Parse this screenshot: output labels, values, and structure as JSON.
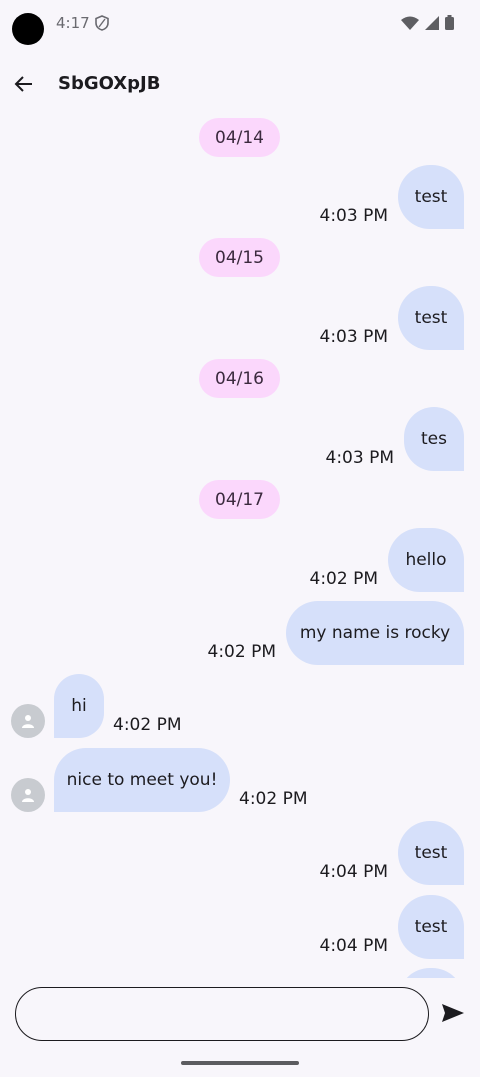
{
  "status_bar": {
    "time": "4:17"
  },
  "app_bar": {
    "title": "SbGOXpJB"
  },
  "dates": {
    "d1": "04/14",
    "d2": "04/15",
    "d3": "04/16",
    "d4": "04/17"
  },
  "messages": [
    {
      "text": "test",
      "time": "4:03 PM"
    },
    {
      "text": "test",
      "time": "4:03 PM"
    },
    {
      "text": "tes",
      "time": "4:03 PM"
    },
    {
      "text": "hello",
      "time": "4:02 PM"
    },
    {
      "text": "my name is rocky",
      "time": "4:02 PM"
    },
    {
      "text": "hi",
      "time": "4:02 PM"
    },
    {
      "text": "nice to meet you!",
      "time": "4:02 PM"
    },
    {
      "text": "test",
      "time": "4:04 PM"
    },
    {
      "text": "test",
      "time": "4:04 PM"
    }
  ],
  "composer": {
    "placeholder": ""
  },
  "icons": {
    "back": "arrow-back-icon",
    "send": "send-icon",
    "avatar": "person-icon"
  },
  "colors": {
    "outgoing_bubble": "#d6e0fa",
    "incoming_bubble": "#d6e0fa",
    "date_pill": "#fbd7fc",
    "background": "#f8f6fb"
  }
}
